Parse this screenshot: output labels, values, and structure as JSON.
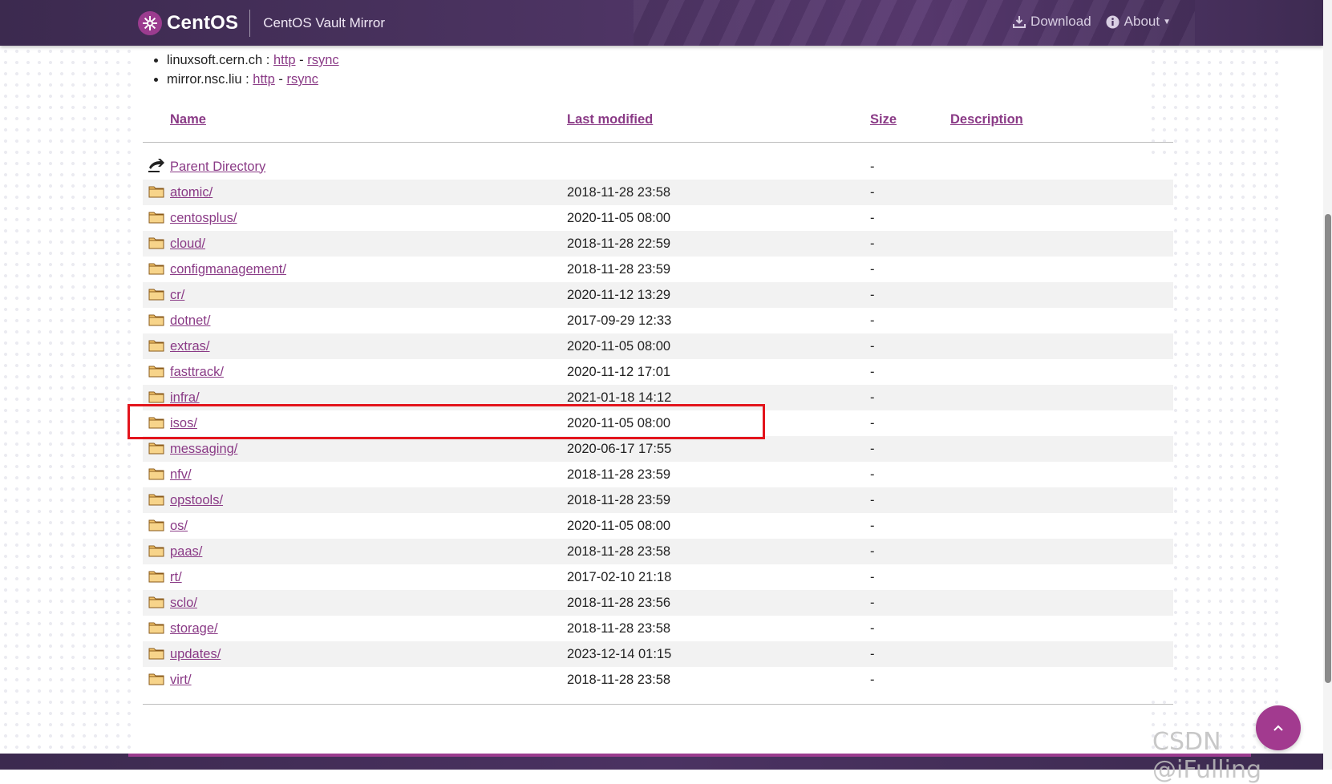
{
  "header": {
    "brand": "CentOS",
    "subtitle": "CentOS Vault Mirror",
    "nav": [
      {
        "label": "Download",
        "icon": "download-icon"
      },
      {
        "label": "About",
        "icon": "info-icon"
      }
    ]
  },
  "mirrors": [
    {
      "host": "linuxsoft.cern.ch :",
      "http": "http",
      "sep": "-",
      "rsync": "rsync"
    },
    {
      "host": "mirror.nsc.liu :",
      "http": "http",
      "sep": "-",
      "rsync": "rsync"
    }
  ],
  "table": {
    "headers": {
      "name": "Name",
      "modified": "Last modified",
      "size": "Size",
      "description": "Description"
    },
    "rows": [
      {
        "name": "Parent Directory",
        "modified": "",
        "size": "-",
        "icon": "parent-directory-icon"
      },
      {
        "name": "atomic/",
        "modified": "2018-11-28 23:58",
        "size": "-",
        "icon": "folder-icon"
      },
      {
        "name": "centosplus/",
        "modified": "2020-11-05 08:00",
        "size": "-",
        "icon": "folder-icon"
      },
      {
        "name": "cloud/",
        "modified": "2018-11-28 22:59",
        "size": "-",
        "icon": "folder-icon"
      },
      {
        "name": "configmanagement/",
        "modified": "2018-11-28 23:59",
        "size": "-",
        "icon": "folder-icon"
      },
      {
        "name": "cr/",
        "modified": "2020-11-12 13:29",
        "size": "-",
        "icon": "folder-icon"
      },
      {
        "name": "dotnet/",
        "modified": "2017-09-29 12:33",
        "size": "-",
        "icon": "folder-icon"
      },
      {
        "name": "extras/",
        "modified": "2020-11-05 08:00",
        "size": "-",
        "icon": "folder-icon"
      },
      {
        "name": "fasttrack/",
        "modified": "2020-11-12 17:01",
        "size": "-",
        "icon": "folder-icon"
      },
      {
        "name": "infra/",
        "modified": "2021-01-18 14:12",
        "size": "-",
        "icon": "folder-icon"
      },
      {
        "name": "isos/",
        "modified": "2020-11-05 08:00",
        "size": "-",
        "icon": "folder-icon"
      },
      {
        "name": "messaging/",
        "modified": "2020-06-17 17:55",
        "size": "-",
        "icon": "folder-icon"
      },
      {
        "name": "nfv/",
        "modified": "2018-11-28 23:59",
        "size": "-",
        "icon": "folder-icon"
      },
      {
        "name": "opstools/",
        "modified": "2018-11-28 23:59",
        "size": "-",
        "icon": "folder-icon"
      },
      {
        "name": "os/",
        "modified": "2020-11-05 08:00",
        "size": "-",
        "icon": "folder-icon"
      },
      {
        "name": "paas/",
        "modified": "2018-11-28 23:58",
        "size": "-",
        "icon": "folder-icon"
      },
      {
        "name": "rt/",
        "modified": "2017-02-10 21:18",
        "size": "-",
        "icon": "folder-icon"
      },
      {
        "name": "sclo/",
        "modified": "2018-11-28 23:56",
        "size": "-",
        "icon": "folder-icon"
      },
      {
        "name": "storage/",
        "modified": "2018-11-28 23:58",
        "size": "-",
        "icon": "folder-icon"
      },
      {
        "name": "updates/",
        "modified": "2023-12-14 01:15",
        "size": "-",
        "icon": "folder-icon"
      },
      {
        "name": "virt/",
        "modified": "2018-11-28 23:58",
        "size": "-",
        "icon": "folder-icon"
      }
    ]
  },
  "watermark": "CSDN @iFulling",
  "colors": {
    "header": "#4a3260",
    "link": "#8a3a86",
    "accent": "#a23a8f",
    "highlight": "#e3141c"
  }
}
